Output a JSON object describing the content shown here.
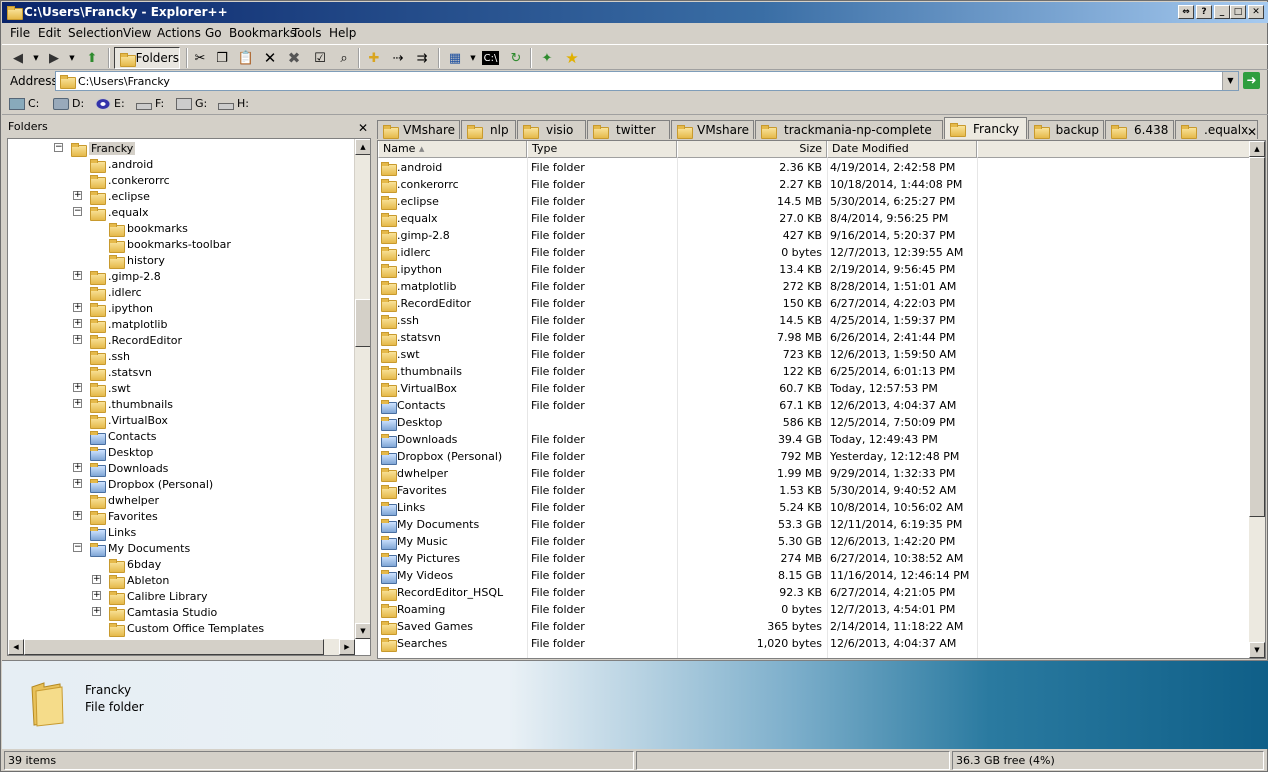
{
  "window": {
    "title": "C:\\Users\\Francky - Explorer++"
  },
  "menu": [
    "File",
    "Edit",
    "Selection",
    "View",
    "Actions",
    "Go",
    "Bookmarks",
    "Tools",
    "Help"
  ],
  "toolbar": {
    "folders_label": "Folders"
  },
  "address": {
    "label": "Address",
    "value": "C:\\Users\\Francky"
  },
  "drives": [
    "C:",
    "D:",
    "E:",
    "F:",
    "G:",
    "H:"
  ],
  "folders_pane": {
    "title": "Folders"
  },
  "tree": [
    {
      "label": "Francky",
      "depth": 0,
      "exp": "-",
      "sel": true
    },
    {
      "label": ".android",
      "depth": 1,
      "exp": ""
    },
    {
      "label": ".conkerorrc",
      "depth": 1,
      "exp": ""
    },
    {
      "label": ".eclipse",
      "depth": 1,
      "exp": "+"
    },
    {
      "label": ".equalx",
      "depth": 1,
      "exp": "-"
    },
    {
      "label": "bookmarks",
      "depth": 2,
      "exp": ""
    },
    {
      "label": "bookmarks-toolbar",
      "depth": 2,
      "exp": ""
    },
    {
      "label": "history",
      "depth": 2,
      "exp": ""
    },
    {
      "label": ".gimp-2.8",
      "depth": 1,
      "exp": "+"
    },
    {
      "label": ".idlerc",
      "depth": 1,
      "exp": ""
    },
    {
      "label": ".ipython",
      "depth": 1,
      "exp": "+"
    },
    {
      "label": ".matplotlib",
      "depth": 1,
      "exp": "+"
    },
    {
      "label": ".RecordEditor",
      "depth": 1,
      "exp": "+"
    },
    {
      "label": ".ssh",
      "depth": 1,
      "exp": ""
    },
    {
      "label": ".statsvn",
      "depth": 1,
      "exp": ""
    },
    {
      "label": ".swt",
      "depth": 1,
      "exp": "+"
    },
    {
      "label": ".thumbnails",
      "depth": 1,
      "exp": "+"
    },
    {
      "label": ".VirtualBox",
      "depth": 1,
      "exp": ""
    },
    {
      "label": "Contacts",
      "depth": 1,
      "exp": "",
      "sp": true
    },
    {
      "label": "Desktop",
      "depth": 1,
      "exp": "",
      "sp": true
    },
    {
      "label": "Downloads",
      "depth": 1,
      "exp": "+",
      "sp": true
    },
    {
      "label": "Dropbox (Personal)",
      "depth": 1,
      "exp": "+",
      "sp": true
    },
    {
      "label": "dwhelper",
      "depth": 1,
      "exp": ""
    },
    {
      "label": "Favorites",
      "depth": 1,
      "exp": "+"
    },
    {
      "label": "Links",
      "depth": 1,
      "exp": "",
      "sp": true
    },
    {
      "label": "My Documents",
      "depth": 1,
      "exp": "-",
      "sp": true
    },
    {
      "label": "6bday",
      "depth": 2,
      "exp": ""
    },
    {
      "label": "Ableton",
      "depth": 2,
      "exp": "+"
    },
    {
      "label": "Calibre Library",
      "depth": 2,
      "exp": "+"
    },
    {
      "label": "Camtasia Studio",
      "depth": 2,
      "exp": "+"
    },
    {
      "label": "Custom Office Templates",
      "depth": 2,
      "exp": ""
    }
  ],
  "tabs": [
    "VMshare",
    "nlp",
    "visio",
    "twitter",
    "VMshare",
    "trackmania-np-complete",
    "Francky",
    "backup",
    "6.438",
    ".equalx"
  ],
  "active_tab": 6,
  "columns": {
    "name": "Name",
    "type": "Type",
    "size": "Size",
    "date": "Date Modified"
  },
  "files": [
    {
      "name": ".android",
      "type": "File folder",
      "size": "2.36 KB",
      "date": "4/19/2014, 2:42:58 PM"
    },
    {
      "name": ".conkerorrc",
      "type": "File folder",
      "size": "2.27 KB",
      "date": "10/18/2014, 1:44:08 PM"
    },
    {
      "name": ".eclipse",
      "type": "File folder",
      "size": "14.5 MB",
      "date": "5/30/2014, 6:25:27 PM"
    },
    {
      "name": ".equalx",
      "type": "File folder",
      "size": "27.0 KB",
      "date": "8/4/2014, 9:56:25 PM"
    },
    {
      "name": ".gimp-2.8",
      "type": "File folder",
      "size": "427 KB",
      "date": "9/16/2014, 5:20:37 PM"
    },
    {
      "name": ".idlerc",
      "type": "File folder",
      "size": "0 bytes",
      "date": "12/7/2013, 12:39:55 AM"
    },
    {
      "name": ".ipython",
      "type": "File folder",
      "size": "13.4 KB",
      "date": "2/19/2014, 9:56:45 PM"
    },
    {
      "name": ".matplotlib",
      "type": "File folder",
      "size": "272 KB",
      "date": "8/28/2014, 1:51:01 AM"
    },
    {
      "name": ".RecordEditor",
      "type": "File folder",
      "size": "150 KB",
      "date": "6/27/2014, 4:22:03 PM"
    },
    {
      "name": ".ssh",
      "type": "File folder",
      "size": "14.5 KB",
      "date": "4/25/2014, 1:59:37 PM"
    },
    {
      "name": ".statsvn",
      "type": "File folder",
      "size": "7.98 MB",
      "date": "6/26/2014, 2:41:44 PM"
    },
    {
      "name": ".swt",
      "type": "File folder",
      "size": "723 KB",
      "date": "12/6/2013, 1:59:50 AM"
    },
    {
      "name": ".thumbnails",
      "type": "File folder",
      "size": "122 KB",
      "date": "6/25/2014, 6:01:13 PM"
    },
    {
      "name": ".VirtualBox",
      "type": "File folder",
      "size": "60.7 KB",
      "date": "Today, 12:57:53 PM"
    },
    {
      "name": "Contacts",
      "type": "File folder",
      "size": "67.1 KB",
      "date": "12/6/2013, 4:04:37 AM",
      "sp": true
    },
    {
      "name": "Desktop",
      "type": "",
      "size": "586 KB",
      "date": "12/5/2014, 7:50:09 PM",
      "sp": true
    },
    {
      "name": "Downloads",
      "type": "File folder",
      "size": "39.4 GB",
      "date": "Today, 12:49:43 PM",
      "sp": true
    },
    {
      "name": "Dropbox (Personal)",
      "type": "File folder",
      "size": "792 MB",
      "date": "Yesterday, 12:12:48 PM",
      "sp": true
    },
    {
      "name": "dwhelper",
      "type": "File folder",
      "size": "1.99 MB",
      "date": "9/29/2014, 1:32:33 PM"
    },
    {
      "name": "Favorites",
      "type": "File folder",
      "size": "1.53 KB",
      "date": "5/30/2014, 9:40:52 AM"
    },
    {
      "name": "Links",
      "type": "File folder",
      "size": "5.24 KB",
      "date": "10/8/2014, 10:56:02 AM",
      "sp": true
    },
    {
      "name": "My Documents",
      "type": "File folder",
      "size": "53.3 GB",
      "date": "12/11/2014, 6:19:35 PM",
      "sp": true
    },
    {
      "name": "My Music",
      "type": "File folder",
      "size": "5.30 GB",
      "date": "12/6/2013, 1:42:20 PM",
      "sp": true
    },
    {
      "name": "My Pictures",
      "type": "File folder",
      "size": "274 MB",
      "date": "6/27/2014, 10:38:52 AM",
      "sp": true
    },
    {
      "name": "My Videos",
      "type": "File folder",
      "size": "8.15 GB",
      "date": "11/16/2014, 12:46:14 PM",
      "sp": true
    },
    {
      "name": "RecordEditor_HSQL",
      "type": "File folder",
      "size": "92.3 KB",
      "date": "6/27/2014, 4:21:05 PM"
    },
    {
      "name": "Roaming",
      "type": "File folder",
      "size": "0 bytes",
      "date": "12/7/2013, 4:54:01 PM"
    },
    {
      "name": "Saved Games",
      "type": "File folder",
      "size": "365 bytes",
      "date": "2/14/2014, 11:18:22 AM"
    },
    {
      "name": "Searches",
      "type": "File folder",
      "size": "1,020 bytes",
      "date": "12/6/2013, 4:04:37 AM"
    }
  ],
  "preview": {
    "name": "Francky",
    "type": "File folder"
  },
  "status": {
    "items": "39 items",
    "free": "36.3 GB free (4%)"
  }
}
